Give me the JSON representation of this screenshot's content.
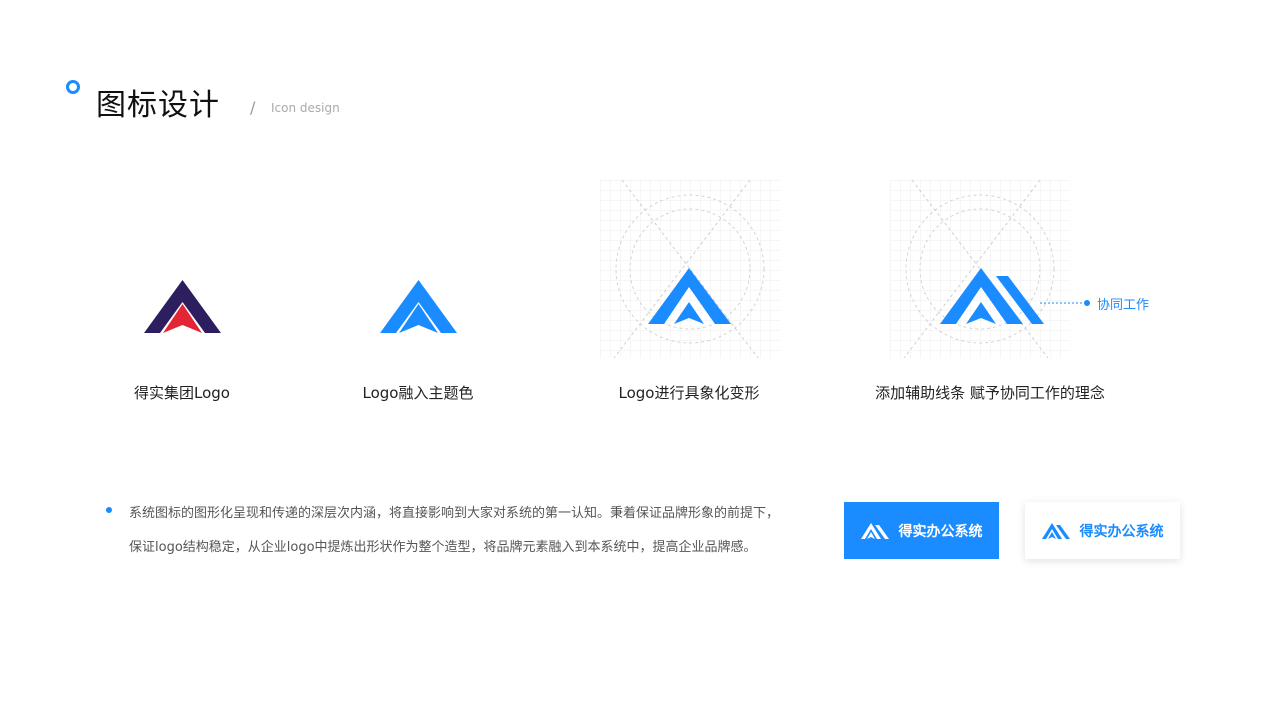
{
  "header": {
    "title": "图标设计",
    "separator": "/",
    "subtitle": "Icon design"
  },
  "steps": [
    {
      "caption": "得实集团Logo",
      "icon": "original-logo-icon"
    },
    {
      "caption": "Logo融入主题色",
      "icon": "theme-color-logo-icon"
    },
    {
      "caption": "Logo进行具象化变形",
      "icon": "grid-logo-icon"
    },
    {
      "caption": "添加辅助线条  赋予协同工作的理念",
      "icon": "grid-logo-with-lines-icon"
    }
  ],
  "callout": "协同工作",
  "description": {
    "line1": "系统图标的图形化呈现和传递的深层次内涵，将直接影响到大家对系统的第一认知。秉着保证品牌形象的前提下，",
    "line2": "保证logo结构稳定，从企业logo中提炼出形状作为整个造型，将品牌元素融入到本系统中，提高企业品牌感。"
  },
  "badges": {
    "primary_label": "得实办公系统",
    "secondary_label": "得实办公系统"
  },
  "colors": {
    "accent": "#1a8cff",
    "original_dark": "#2d1e5f",
    "original_red": "#e32636"
  }
}
